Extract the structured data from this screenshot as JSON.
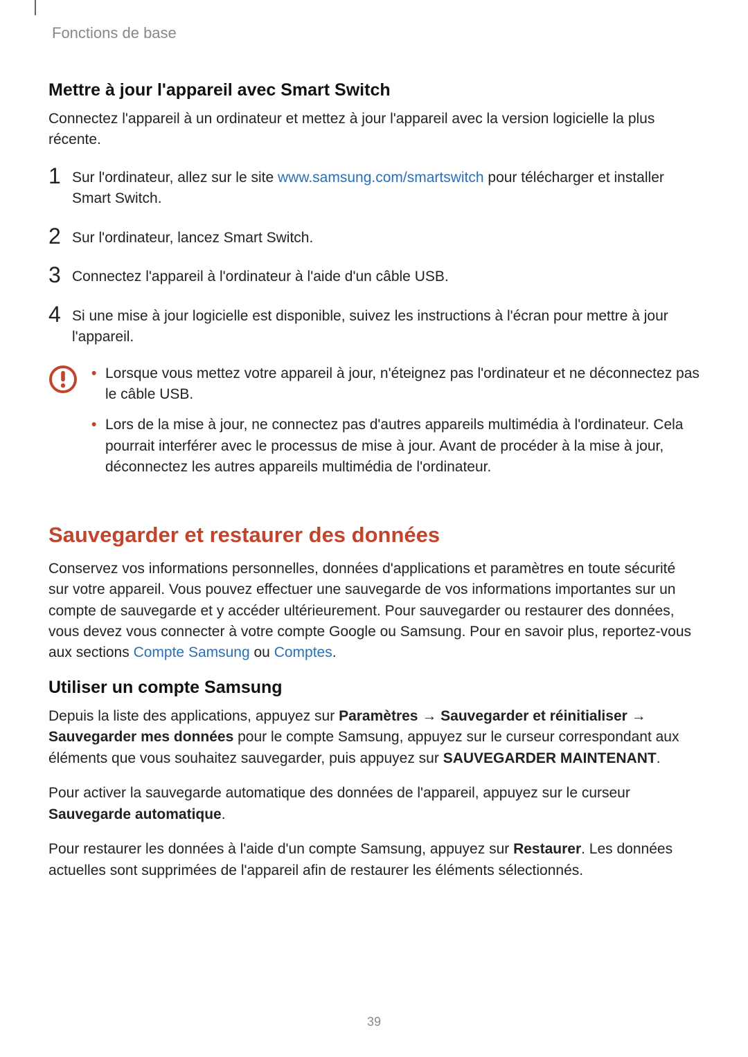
{
  "header": {
    "breadcrumb": "Fonctions de base"
  },
  "section1": {
    "title": "Mettre à jour l'appareil avec Smart Switch",
    "intro": "Connectez l'appareil à un ordinateur et mettez à jour l'appareil avec la version logicielle la plus récente.",
    "steps": {
      "n1": "1",
      "s1a": "Sur l'ordinateur, allez sur le site ",
      "s1link": "www.samsung.com/smartswitch",
      "s1b": " pour télécharger et installer Smart Switch.",
      "n2": "2",
      "s2": "Sur l'ordinateur, lancez Smart Switch.",
      "n3": "3",
      "s3": "Connectez l'appareil à l'ordinateur à l'aide d'un câble USB.",
      "n4": "4",
      "s4": "Si une mise à jour logicielle est disponible, suivez les instructions à l'écran pour mettre à jour l'appareil."
    },
    "warnings": {
      "w1": "Lorsque vous mettez votre appareil à jour, n'éteignez pas l'ordinateur et ne déconnectez pas le câble USB.",
      "w2": "Lors de la mise à jour, ne connectez pas d'autres appareils multimédia à l'ordinateur. Cela pourrait interférer avec le processus de mise à jour. Avant de procéder à la mise à jour, déconnectez les autres appareils multimédia de l'ordinateur."
    }
  },
  "section2": {
    "title": "Sauvegarder et restaurer des données",
    "p1a": "Conservez vos informations personnelles, données d'applications et paramètres en toute sécurité sur votre appareil. Vous pouvez effectuer une sauvegarde de vos informations importantes sur un compte de sauvegarde et y accéder ultérieurement. Pour sauvegarder ou restaurer des données, vous devez vous connecter à votre compte Google ou Samsung. Pour en savoir plus, reportez-vous aux sections ",
    "link1": "Compte Samsung",
    "p1b": " ou ",
    "link2": "Comptes",
    "p1c": "."
  },
  "section3": {
    "title": "Utiliser un compte Samsung",
    "p1a": "Depuis la liste des applications, appuyez sur ",
    "b1": "Paramètres",
    "arrow": " → ",
    "b2": "Sauvegarder et réinitialiser",
    "b3": "Sauvegarder mes données",
    "p1b": " pour le compte Samsung, appuyez sur le curseur correspondant aux éléments que vous souhaitez sauvegarder, puis appuyez sur ",
    "b4": "SAUVEGARDER MAINTENANT",
    "p1c": ".",
    "p2a": "Pour activer la sauvegarde automatique des données de l'appareil, appuyez sur le curseur ",
    "b5": "Sauvegarde automatique",
    "p2b": ".",
    "p3a": "Pour restaurer les données à l'aide d'un compte Samsung, appuyez sur ",
    "b6": "Restaurer",
    "p3b": ". Les données actuelles sont supprimées de l'appareil afin de restaurer les éléments sélectionnés."
  },
  "pageNumber": "39"
}
